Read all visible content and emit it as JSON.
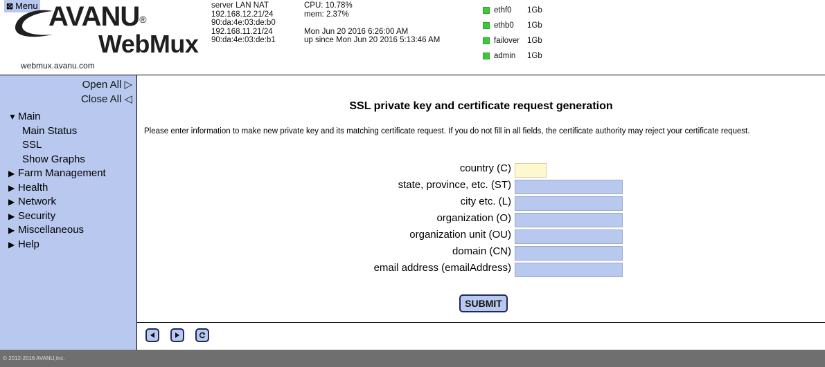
{
  "header": {
    "menu_label": "Menu",
    "logo_brand": "AVANU",
    "logo_reg": "®",
    "logo_product": "WebMux",
    "logo_url": "webmux.avanu.com",
    "network": [
      "server LAN NAT",
      "192.168.12.21/24",
      "90:da:4e:03:de:b0",
      "192.168.11.21/24",
      "90:da:4e:03:de:b1"
    ],
    "cpu": "CPU: 10.78%",
    "mem": "mem: 2.37%",
    "datetime": "Mon Jun 20 2016 6:26:00 AM",
    "uptime": "up since Mon Jun 20 2016 5:13:46 AM",
    "interfaces": [
      {
        "name": "ethf0",
        "speed": "1Gb",
        "status_color": "#3ec83a"
      },
      {
        "name": "ethb0",
        "speed": "1Gb",
        "status_color": "#3ec83a"
      },
      {
        "name": "failover",
        "speed": "1Gb",
        "status_color": "#3ec83a"
      },
      {
        "name": "admin",
        "speed": "1Gb",
        "status_color": "#3ec83a"
      }
    ]
  },
  "sidebar": {
    "open_all": "Open All ▷",
    "close_all": "Close All ◁",
    "main": {
      "label": "Main",
      "expanded": true
    },
    "main_items": [
      "Main Status",
      "SSL",
      "Show Graphs"
    ],
    "sections": [
      "Farm Management",
      "Health",
      "Network",
      "Security",
      "Miscellaneous",
      "Help"
    ]
  },
  "page": {
    "title": "SSL private key and certificate request generation",
    "intro": "Please enter information to make new private key and its matching certificate request. If you do not fill in all fields, the certificate authority may reject your certificate request.",
    "fields": [
      {
        "label": "country (C)",
        "value": ""
      },
      {
        "label": "state, province, etc. (ST)",
        "value": ""
      },
      {
        "label": "city etc. (L)",
        "value": ""
      },
      {
        "label": "organization (O)",
        "value": ""
      },
      {
        "label": "organization unit (OU)",
        "value": ""
      },
      {
        "label": "domain (CN)",
        "value": ""
      },
      {
        "label": "email address (emailAddress)",
        "value": ""
      }
    ],
    "submit_label": "SUBMIT"
  },
  "footer": {
    "copyright": "© 2012-2016 AVANU,Inc."
  },
  "colors": {
    "sidebar_bg": "#b8c8ee",
    "status_bar": "#6f6f6f",
    "country_field": "#fdf8d0"
  }
}
